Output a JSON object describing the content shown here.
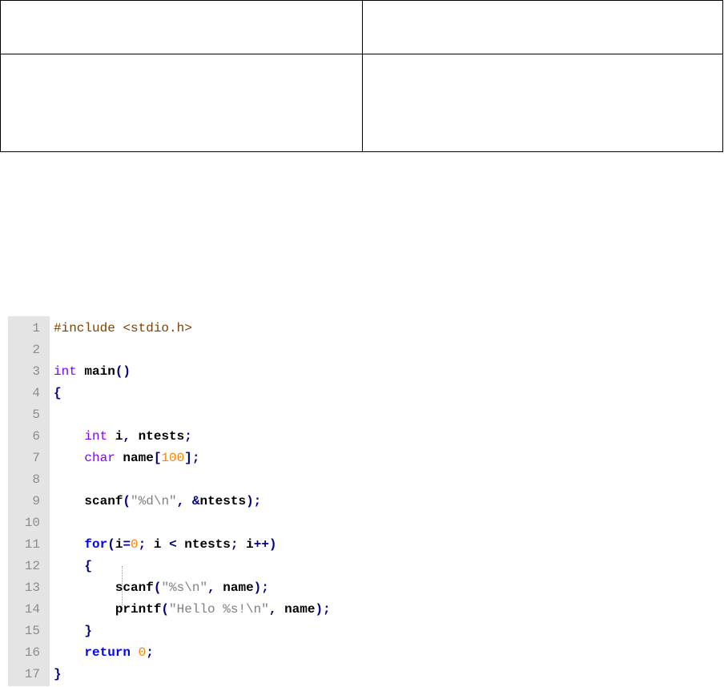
{
  "table": {
    "rows": [
      [
        "",
        ""
      ],
      [
        "",
        ""
      ]
    ]
  },
  "code": {
    "lines": [
      {
        "n": "1",
        "tokens": [
          {
            "t": "#include <stdio.h>",
            "c": "pre"
          }
        ]
      },
      {
        "n": "2",
        "tokens": []
      },
      {
        "n": "3",
        "tokens": [
          {
            "t": "int",
            "c": "kw-type"
          },
          {
            "t": " main",
            "c": "id"
          },
          {
            "t": "()",
            "c": "op"
          }
        ]
      },
      {
        "n": "4",
        "tokens": [
          {
            "t": "{",
            "c": "op"
          }
        ]
      },
      {
        "n": "5",
        "tokens": []
      },
      {
        "n": "6",
        "tokens": [
          {
            "t": "    ",
            "c": "id"
          },
          {
            "t": "int",
            "c": "kw-type"
          },
          {
            "t": " i",
            "c": "id"
          },
          {
            "t": ",",
            "c": "op"
          },
          {
            "t": " ntests",
            "c": "id"
          },
          {
            "t": ";",
            "c": "op"
          }
        ]
      },
      {
        "n": "7",
        "tokens": [
          {
            "t": "    ",
            "c": "id"
          },
          {
            "t": "char",
            "c": "kw-type"
          },
          {
            "t": " name",
            "c": "id"
          },
          {
            "t": "[",
            "c": "op"
          },
          {
            "t": "100",
            "c": "num"
          },
          {
            "t": "];",
            "c": "op"
          }
        ]
      },
      {
        "n": "8",
        "tokens": []
      },
      {
        "n": "9",
        "tokens": [
          {
            "t": "    scanf",
            "c": "id"
          },
          {
            "t": "(",
            "c": "op"
          },
          {
            "t": "\"%d\\n\"",
            "c": "str"
          },
          {
            "t": ",",
            "c": "op"
          },
          {
            "t": " ",
            "c": "id"
          },
          {
            "t": "&",
            "c": "op"
          },
          {
            "t": "ntests",
            "c": "id"
          },
          {
            "t": ");",
            "c": "op"
          }
        ]
      },
      {
        "n": "10",
        "tokens": []
      },
      {
        "n": "11",
        "tokens": [
          {
            "t": "    ",
            "c": "id"
          },
          {
            "t": "for",
            "c": "kw"
          },
          {
            "t": "(",
            "c": "op"
          },
          {
            "t": "i",
            "c": "id"
          },
          {
            "t": "=",
            "c": "op"
          },
          {
            "t": "0",
            "c": "num"
          },
          {
            "t": ";",
            "c": "op"
          },
          {
            "t": " i ",
            "c": "id"
          },
          {
            "t": "<",
            "c": "op"
          },
          {
            "t": " ntests",
            "c": "id"
          },
          {
            "t": ";",
            "c": "op"
          },
          {
            "t": " i",
            "c": "id"
          },
          {
            "t": "++)",
            "c": "op"
          }
        ]
      },
      {
        "n": "12",
        "tokens": [
          {
            "t": "    ",
            "c": "id"
          },
          {
            "t": "{",
            "c": "op"
          }
        ]
      },
      {
        "n": "13",
        "tokens": [
          {
            "t": "        scanf",
            "c": "id"
          },
          {
            "t": "(",
            "c": "op"
          },
          {
            "t": "\"%s\\n\"",
            "c": "str"
          },
          {
            "t": ",",
            "c": "op"
          },
          {
            "t": " name",
            "c": "id"
          },
          {
            "t": ");",
            "c": "op"
          }
        ]
      },
      {
        "n": "14",
        "tokens": [
          {
            "t": "        printf",
            "c": "id"
          },
          {
            "t": "(",
            "c": "op"
          },
          {
            "t": "\"Hello %s!\\n\"",
            "c": "str"
          },
          {
            "t": ",",
            "c": "op"
          },
          {
            "t": " name",
            "c": "id"
          },
          {
            "t": ");",
            "c": "op"
          }
        ]
      },
      {
        "n": "15",
        "tokens": [
          {
            "t": "    ",
            "c": "id"
          },
          {
            "t": "}",
            "c": "op"
          }
        ]
      },
      {
        "n": "16",
        "tokens": [
          {
            "t": "    ",
            "c": "id"
          },
          {
            "t": "return",
            "c": "kw"
          },
          {
            "t": " ",
            "c": "id"
          },
          {
            "t": "0",
            "c": "num"
          },
          {
            "t": ";",
            "c": "op"
          }
        ]
      },
      {
        "n": "17",
        "tokens": [
          {
            "t": "}",
            "c": "op"
          }
        ]
      }
    ]
  },
  "colors": {
    "preprocessor": "#804000",
    "type_keyword": "#8000ff",
    "keyword": "#0000ff",
    "number": "#ff8000",
    "string": "#808080",
    "operator": "#000080",
    "line_number": "#8c8c8c",
    "gutter": "#e4e4e4"
  }
}
